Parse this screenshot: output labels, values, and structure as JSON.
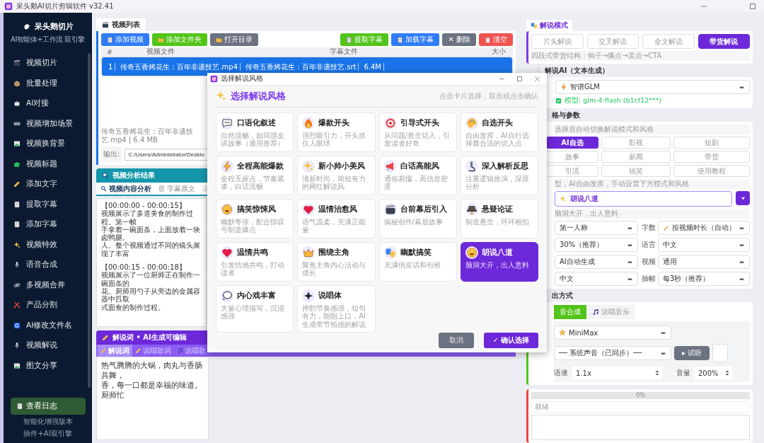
{
  "window": {
    "title": "呆头鹅AI切片剪辑软件 v32.41"
  },
  "sidebar": {
    "brand": "呆头鹅切片",
    "subtitle": "AI智能体+工作流 双引擎",
    "items": [
      {
        "label": "视频切片",
        "selected": false
      },
      {
        "label": "批量处理",
        "selected": false
      },
      {
        "label": "AI对接",
        "selected": false
      },
      {
        "label": "视频增加场景",
        "selected": false
      },
      {
        "label": "视频换背景",
        "selected": false
      },
      {
        "label": "视频标题",
        "selected": false
      },
      {
        "label": "添加文字",
        "selected": false
      },
      {
        "label": "提取字幕",
        "selected": false
      },
      {
        "label": "添加字幕",
        "selected": false
      },
      {
        "label": "视频特效",
        "selected": false
      },
      {
        "label": "语音合成",
        "selected": false
      },
      {
        "label": "多视频合并",
        "selected": false
      },
      {
        "label": "产品分割",
        "selected": false
      },
      {
        "label": "AI修改文件名",
        "selected": false
      },
      {
        "label": "视频解说",
        "selected": false
      },
      {
        "label": "图文分享",
        "selected": false
      }
    ],
    "log_button": "查看日志",
    "footer": [
      "智能化增强版本",
      "插件+AI双引擎"
    ]
  },
  "video_list": {
    "tab": "视频列表",
    "buttons_left": [
      {
        "label": "添加视频",
        "kind": "primary"
      },
      {
        "label": "添加文件夹",
        "kind": "success"
      },
      {
        "label": "打开目录",
        "kind": "secondary"
      }
    ],
    "buttons_right": [
      {
        "label": "提取字幕",
        "kind": "success"
      },
      {
        "label": "加载字幕",
        "kind": "primary"
      },
      {
        "label": "✕ 删除",
        "kind": "secondary"
      },
      {
        "label": "清空",
        "kind": "danger"
      }
    ],
    "table": {
      "columns": [
        "#",
        "视频文件",
        "字幕文件",
        "大小"
      ],
      "rows": [
        {
          "cells": [
            "1",
            "传奇五香烤花生：百年非遗技艺.mp4",
            "传奇五香烤花生：百年非遗技艺.srt",
            "6.4M"
          ],
          "selected": true
        }
      ]
    },
    "file_info": "传奇五香烤花生：百年非遗技艺.mp4 | 6.4 MB",
    "output": {
      "label": "输出:",
      "value": "C:/Users/Administrator/Deskto"
    }
  },
  "analysis": {
    "title": "视频分析结果",
    "tabs": [
      {
        "label": "视频内容分析",
        "selected": true
      },
      {
        "label": "字幕原文",
        "selected": false
      }
    ],
    "segments": [
      {
        "time": "【00:00:00 - 00:00:15】",
        "lines": [
          "视频展示了多道美食的制作过程。第一帧",
          "手拿着一碗面条，上面放着一块卤鸭腿。",
          "人。整个视频通过不同的镜头展现了丰富"
        ]
      },
      {
        "time": "【00:00:15 - 00:00:18】",
        "lines": [
          "视频展示了一位厨师正在制作一碗面条的",
          "花。厨师用勺子从旁边的金属容器中舀取",
          "式面食的制作过程。"
        ]
      }
    ]
  },
  "narration": {
    "title": "解说词 • AI生成可编辑",
    "tabs": [
      {
        "label": "解说词",
        "selected": true
      },
      {
        "label": "说唱歌词",
        "selected": false
      },
      {
        "label": "说唱歌",
        "selected": false
      }
    ],
    "lines": [
      "热气腾腾的大锅，肉丸与香肠共舞，",
      "香，每一口都是幸福的味道。厨师忙"
    ]
  },
  "mode": {
    "title": "解说模式",
    "options": [
      {
        "label": "片头解说",
        "selected": false
      },
      {
        "label": "交叉解说",
        "selected": false
      },
      {
        "label": "全文解说",
        "selected": false
      },
      {
        "label": "带货解说",
        "selected": true
      }
    ],
    "hint": "四段式带货结构：钩子→痛点→卖点→CTA"
  },
  "ai": {
    "title": "解说AI（文本生成）",
    "provider": "智谱GLM",
    "model": "模型: glm-4-flash (b1cf12***)"
  },
  "style_params": {
    "title": "格与参数",
    "hint": "选择后自动切换解说模式和风格",
    "presets": [
      {
        "label": "AI自选",
        "selected": true
      },
      {
        "label": "影视",
        "selected": false
      },
      {
        "label": "短剧",
        "selected": false
      },
      {
        "label": "故事",
        "selected": false
      },
      {
        "label": "新闻",
        "selected": false
      },
      {
        "label": "带货",
        "selected": false
      },
      {
        "label": "引流",
        "selected": false
      },
      {
        "label": "搞笑",
        "selected": false
      },
      {
        "label": "使用教程",
        "selected": false
      }
    ],
    "preset_hint": "型，AI自由发挥，手动设置下方模式和风格",
    "style": "胡说八道",
    "style_hint": "脑洞大开，出人意料",
    "left_values": [
      "第一人称",
      "30%（推荐）",
      "AI自动生成",
      "中文"
    ],
    "right_params": [
      {
        "label": "字数",
        "value": "按视频时长（自动）"
      },
      {
        "label": "语言",
        "value": "中文"
      },
      {
        "label": "视频",
        "value": "通用"
      },
      {
        "label": "抽帧",
        "value": "每3秒（推荐）"
      }
    ]
  },
  "output_mode": {
    "title": "出方式",
    "tabs": [
      {
        "label": "音合成",
        "selected": true
      },
      {
        "label": "说唱音乐",
        "selected": false
      }
    ],
    "engine": "MiniMax",
    "voice": "── 系统声音（已同步）──",
    "preview_button": "▸ 试听",
    "speed": {
      "label": "语速",
      "value": "1.1x"
    },
    "volume": {
      "label": "音量",
      "value": "200%"
    }
  },
  "progress": {
    "level": 0,
    "text": "0%"
  },
  "status": "就绪",
  "dialog": {
    "title": "选择解说风格",
    "heading": "选择解说风格",
    "hint": "点击卡片选择，双击或点击确认",
    "styles": [
      {
        "name": "口语化叙述",
        "description": "自然流畅，如同朋友讲故事（通用推荐）",
        "selected": false
      },
      {
        "name": "爆款开头",
        "description": "强烈吸引力，开头抓住人眼球",
        "selected": false
      },
      {
        "name": "引导式开头",
        "description": "从问题/悬念切入，引发读者好奇",
        "selected": false
      },
      {
        "name": "自选开头",
        "description": "自由发挥，AI自行选择最合适的切入点",
        "selected": false
      },
      {
        "name": "全程高能爆款",
        "description": "全程无尿点，节奏紧凑，白话流畅",
        "selected": false
      },
      {
        "name": "新小帅小美风",
        "description": "清新时尚，简短有力的网红解说风",
        "selected": false
      },
      {
        "name": "白话高能风",
        "description": "通俗易懂，高信息密度",
        "selected": false
      },
      {
        "name": "深入解析反思",
        "description": "注重逻辑推演，深度分析",
        "selected": false
      },
      {
        "name": "搞笑惊悚风",
        "description": "幽默夸张，配合惊叹号制造爆点",
        "selected": false
      },
      {
        "name": "温情治愈风",
        "description": "语气温柔，充满正能量",
        "selected": false
      },
      {
        "name": "台前幕后引入",
        "description": "揭秘创作/幕后故事",
        "selected": false
      },
      {
        "name": "悬疑论证",
        "description": "制造悬念，环环相扣",
        "selected": false
      },
      {
        "name": "温情共鸣",
        "description": "引发情感共鸣，打动读者",
        "selected": false
      },
      {
        "name": "围绕主角",
        "description": "聚焦主角内心活动与成长",
        "selected": false
      },
      {
        "name": "幽默搞笑",
        "description": "充满俏皮话和包袱",
        "selected": false
      },
      {
        "name": "胡说八道",
        "description": "脑洞大开，出人意料",
        "selected": true
      },
      {
        "name": "内心戏丰富",
        "description": "大量心理描写，沉浸感强",
        "selected": false
      },
      {
        "name": "说唱体",
        "description": "押韵节奏感强，短句有力，朗朗上口，AI生成带节拍感的解说",
        "selected": false
      }
    ],
    "cancel": "取消",
    "confirm": "✓ 确认选择"
  }
}
